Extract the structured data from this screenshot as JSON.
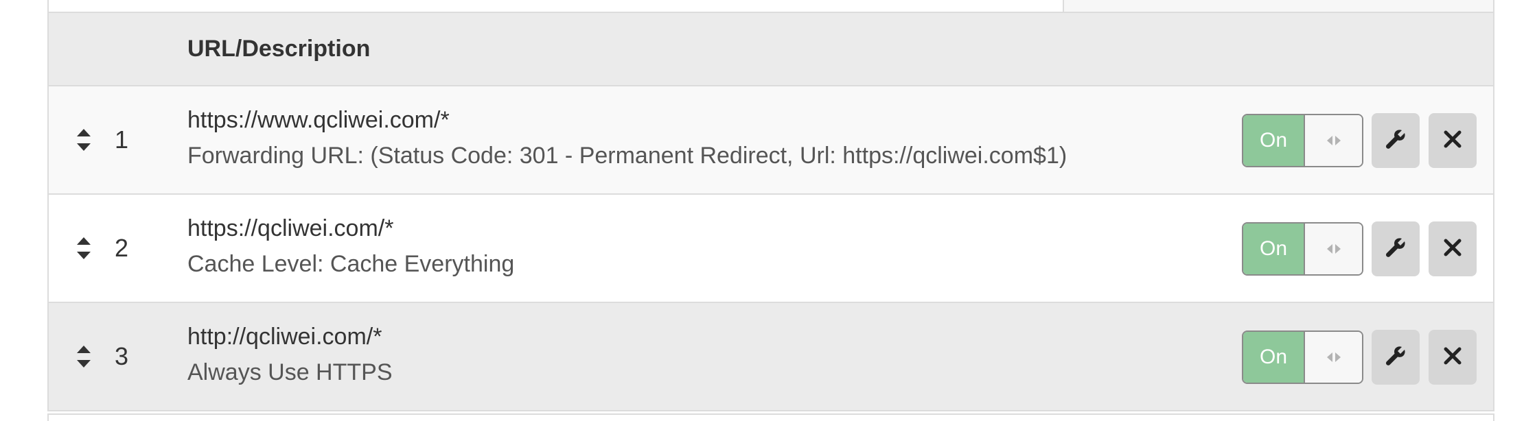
{
  "table": {
    "header": {
      "url_description": "URL/Description"
    },
    "rows": [
      {
        "number": "1",
        "url": "https://www.qcliwei.com/*",
        "description": "Forwarding URL: (Status Code: 301 - Permanent Redirect, Url: https://qcliwei.com$1)",
        "toggle_label": "On"
      },
      {
        "number": "2",
        "url": "https://qcliwei.com/*",
        "description": "Cache Level: Cache Everything",
        "toggle_label": "On"
      },
      {
        "number": "3",
        "url": "http://qcliwei.com/*",
        "description": "Always Use HTTPS",
        "toggle_label": "On"
      }
    ]
  },
  "icons": {
    "sort": "sort-icon",
    "toggle_handle": "drag-arrows-icon",
    "edit": "wrench-icon",
    "delete": "close-icon"
  },
  "colors": {
    "toggle_on": "#8ec89a",
    "header_bg": "#ebebeb",
    "button_bg": "#d6d6d6"
  }
}
